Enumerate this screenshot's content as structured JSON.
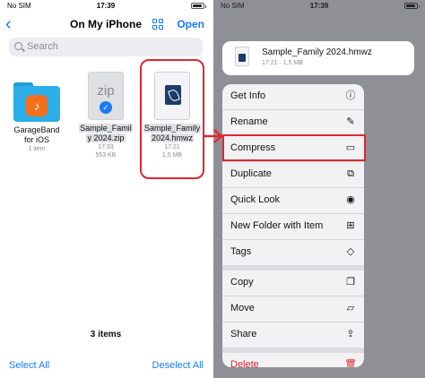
{
  "left": {
    "status": {
      "carrier": "No SIM",
      "time": "17:39"
    },
    "nav": {
      "back": "‹",
      "title": "On My iPhone",
      "open": "Open"
    },
    "search": {
      "placeholder": "Search"
    },
    "files": [
      {
        "name1": "GarageBand",
        "name2": "for iOS",
        "meta1": "1 item",
        "meta2": ""
      },
      {
        "name1": "Sample_Famil",
        "name2": "y 2024.zip",
        "meta1": "17:33",
        "meta2": "553 KB",
        "icon_text": "zip"
      },
      {
        "name1": "Sample_Family",
        "name2": "2024.hmwz",
        "meta1": "17:21",
        "meta2": "1,5 MB"
      }
    ],
    "items_count": "3 items",
    "toolbar": {
      "select_all": "Select All",
      "deselect_all": "Deselect All"
    }
  },
  "right": {
    "status": {
      "carrier": "No SIM",
      "time": "17:39"
    },
    "preview": {
      "name": "Sample_Family 2024.hmwz",
      "meta": "17:21 · 1,5 MB"
    },
    "menu": {
      "get_info": "Get Info",
      "rename": "Rename",
      "compress": "Compress",
      "duplicate": "Duplicate",
      "quick_look": "Quick Look",
      "new_folder": "New Folder with Item",
      "tags": "Tags",
      "copy": "Copy",
      "move": "Move",
      "share": "Share",
      "delete": "Delete"
    }
  },
  "colors": {
    "accent": "#1a7af8",
    "highlight": "#e0262f",
    "delete": "#e0262f"
  }
}
